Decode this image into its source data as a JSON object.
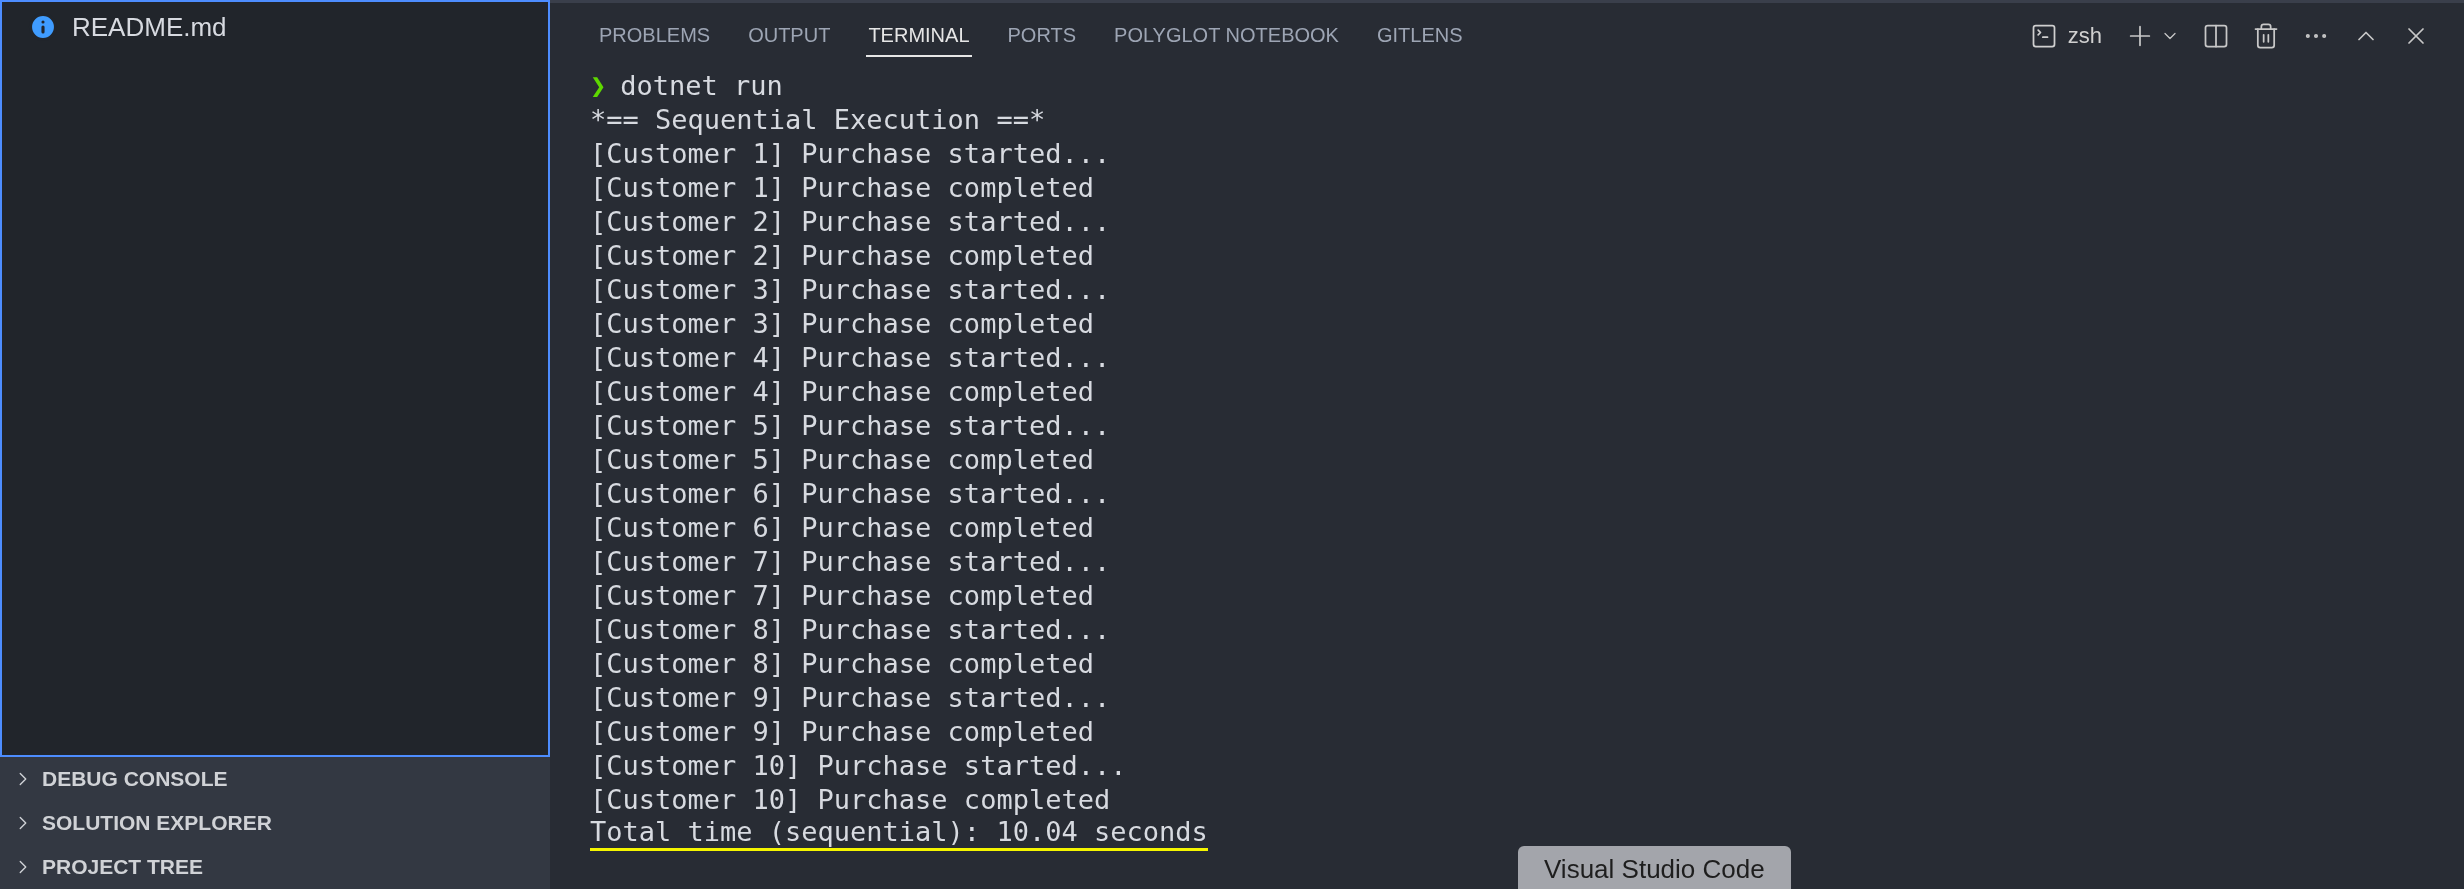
{
  "sidebar": {
    "files": [
      {
        "name": "README.md",
        "selected": false
      }
    ],
    "sections": [
      {
        "label": "DEBUG CONSOLE",
        "expanded": false
      },
      {
        "label": "SOLUTION EXPLORER",
        "expanded": false
      },
      {
        "label": "PROJECT TREE",
        "expanded": false
      }
    ]
  },
  "panel": {
    "tabs": [
      {
        "label": "PROBLEMS",
        "selected": false
      },
      {
        "label": "OUTPUT",
        "selected": false
      },
      {
        "label": "TERMINAL",
        "selected": true
      },
      {
        "label": "PORTS",
        "selected": false
      },
      {
        "label": "POLYGLOT NOTEBOOK",
        "selected": false
      },
      {
        "label": "GITLENS",
        "selected": false
      }
    ],
    "terminal_name": "zsh",
    "lines": [
      {
        "kind": "command",
        "prompt": "❯",
        "text": "dotnet run"
      },
      {
        "kind": "output",
        "text": "*== Sequential Execution ==*"
      },
      {
        "kind": "output",
        "text": "[Customer 1] Purchase started..."
      },
      {
        "kind": "output",
        "text": "[Customer 1] Purchase completed"
      },
      {
        "kind": "output",
        "text": "[Customer 2] Purchase started..."
      },
      {
        "kind": "output",
        "text": "[Customer 2] Purchase completed"
      },
      {
        "kind": "output",
        "text": "[Customer 3] Purchase started..."
      },
      {
        "kind": "output",
        "text": "[Customer 3] Purchase completed"
      },
      {
        "kind": "output",
        "text": "[Customer 4] Purchase started..."
      },
      {
        "kind": "output",
        "text": "[Customer 4] Purchase completed"
      },
      {
        "kind": "output",
        "text": "[Customer 5] Purchase started..."
      },
      {
        "kind": "output",
        "text": "[Customer 5] Purchase completed"
      },
      {
        "kind": "output",
        "text": "[Customer 6] Purchase started..."
      },
      {
        "kind": "output",
        "text": "[Customer 6] Purchase completed"
      },
      {
        "kind": "output",
        "text": "[Customer 7] Purchase started..."
      },
      {
        "kind": "output",
        "text": "[Customer 7] Purchase completed"
      },
      {
        "kind": "output",
        "text": "[Customer 8] Purchase started..."
      },
      {
        "kind": "output",
        "text": "[Customer 8] Purchase completed"
      },
      {
        "kind": "output",
        "text": "[Customer 9] Purchase started..."
      },
      {
        "kind": "output",
        "text": "[Customer 9] Purchase completed"
      },
      {
        "kind": "output",
        "text": "[Customer 10] Purchase started..."
      },
      {
        "kind": "output",
        "text": "[Customer 10] Purchase completed"
      },
      {
        "kind": "underlined",
        "text": "Total time (sequential): 10.04 seconds"
      }
    ]
  },
  "tooltip": {
    "text": "Visual Studio Code"
  }
}
